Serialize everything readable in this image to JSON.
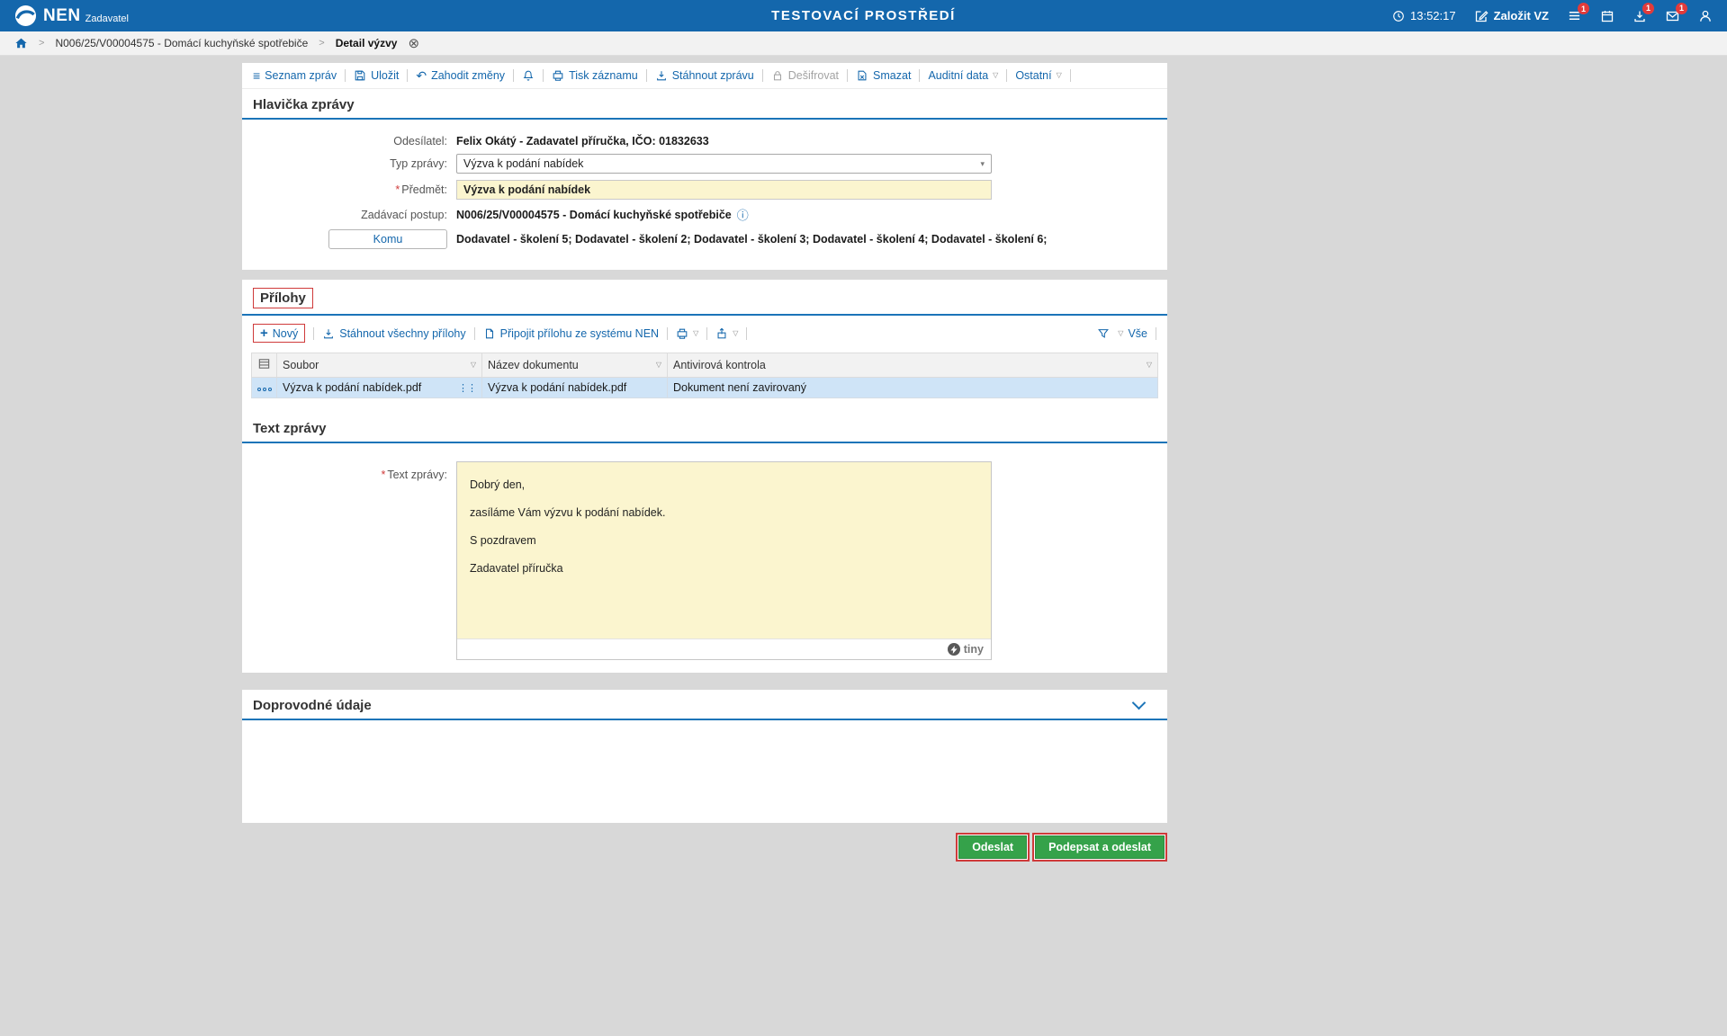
{
  "topbar": {
    "logo": "NEN",
    "logo_sub": "Zadavatel",
    "title": "TESTOVACÍ PROSTŘEDÍ",
    "time": "13:52:17",
    "zalozit_vz": "Založit VZ",
    "menu_badge": "1",
    "download_badge": "1",
    "mail_badge": "1"
  },
  "breadcrumb": {
    "path1": "N006/25/V00004575 - Domácí kuchyňské spotřebiče",
    "current": "Detail výzvy"
  },
  "toolbar": {
    "seznam": "Seznam zpráv",
    "ulozit": "Uložit",
    "zahodit": "Zahodit změny",
    "tisk": "Tisk záznamu",
    "stahnout": "Stáhnout zprávu",
    "desifrovat": "Dešifrovat",
    "smazat": "Smazat",
    "auditni": "Auditní data",
    "ostatni": "Ostatní"
  },
  "header_section": {
    "title": "Hlavička zprávy",
    "odesilatel_label": "Odesílatel:",
    "odesilatel_value": "Felix Okátý - Zadavatel příručka, IČO: 01832633",
    "typ_label": "Typ zprávy:",
    "typ_value": "Výzva k podání nabídek",
    "predmet_label": "Předmět:",
    "predmet_value": "Výzva k podání nabídek",
    "postup_label": "Zadávací postup:",
    "postup_value": "N006/25/V00004575 - Domácí kuchyňské spotřebiče",
    "komu_label": "Komu",
    "komu_value": "Dodavatel - školení 5; Dodavatel - školení 2; Dodavatel - školení 3; Dodavatel - školení 4; Dodavatel - školení 6;"
  },
  "attachments": {
    "title": "Přílohy",
    "novy": "Nový",
    "stahnout_vse": "Stáhnout všechny přílohy",
    "pripojit": "Připojit přílohu ze systému NEN",
    "vse": "Vše",
    "columns": {
      "soubor": "Soubor",
      "nazev": "Název dokumentu",
      "antivir": "Antivirová kontrola"
    },
    "row": {
      "soubor": "Výzva k podání nabídek.pdf",
      "nazev": "Výzva k podání nabídek.pdf",
      "antivir": "Dokument není zavirovaný"
    }
  },
  "message": {
    "title": "Text zprávy",
    "label": "Text zprávy:",
    "lines": [
      "Dobrý den,",
      "zasíláme Vám výzvu k podání nabídek.",
      "S pozdravem",
      "Zadavatel příručka"
    ],
    "editor_brand": "tiny"
  },
  "doprovodne": {
    "title": "Doprovodné údaje"
  },
  "footer": {
    "odeslat": "Odeslat",
    "podepsat": "Podepsat a odeslat"
  },
  "icons": {
    "chevron": ">",
    "close": "⊗",
    "list": "≡",
    "undo": "↶",
    "info": "ⓘ",
    "plus": "+",
    "triangle": "▽",
    "select_chevron": "▾",
    "dots_vertical": "⋮⋮"
  },
  "marks": {
    "required": "*"
  }
}
